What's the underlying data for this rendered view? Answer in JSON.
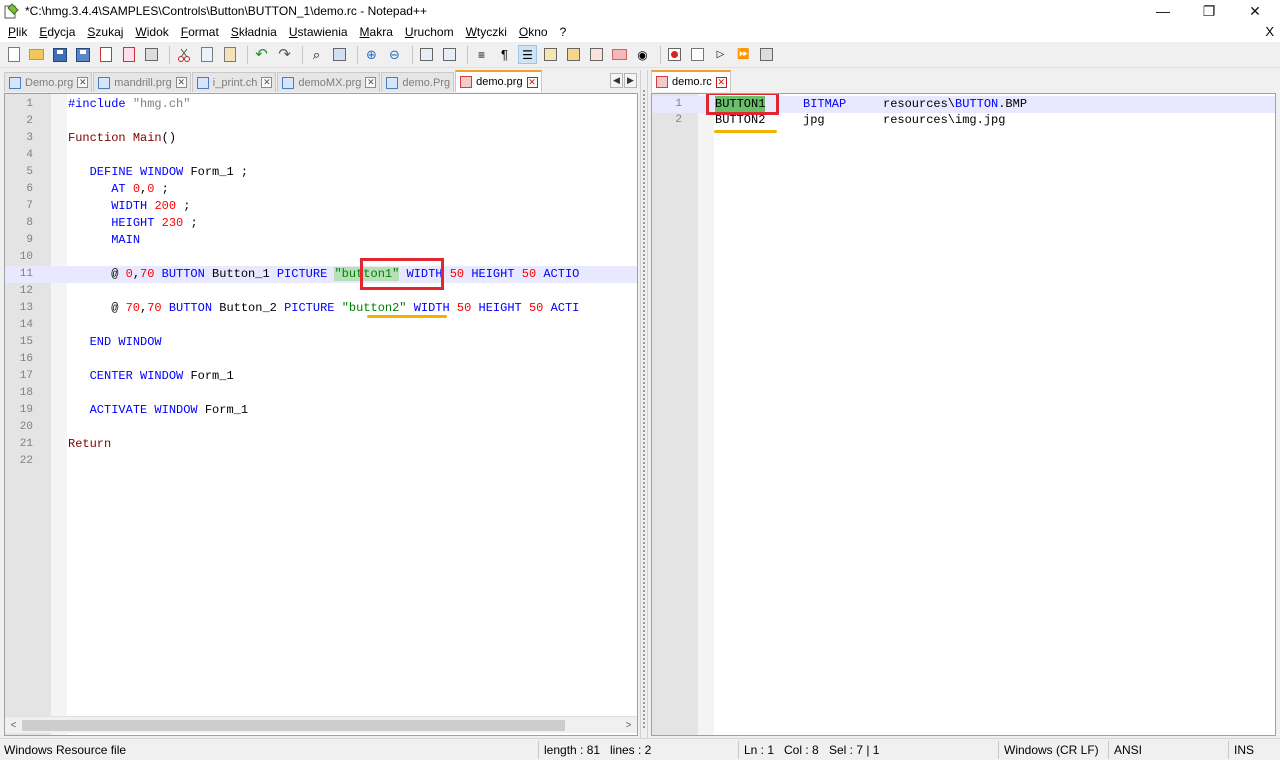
{
  "window": {
    "title": "*C:\\hmg.3.4.4\\SAMPLES\\Controls\\Button\\BUTTON_1\\demo.rc - Notepad++",
    "minimize_glyph": "—",
    "maximize_glyph": "❐",
    "close_glyph": "✕"
  },
  "menu": {
    "items": [
      "Plik",
      "Edycja",
      "Szukaj",
      "Widok",
      "Format",
      "Składnia",
      "Ustawienia",
      "Makra",
      "Uruchom",
      "Wtyczki",
      "Okno",
      "?"
    ],
    "close_label": "X"
  },
  "toolbar": {
    "icons": [
      "new-file",
      "open-file",
      "save",
      "save-all",
      "close",
      "close-all",
      "print",
      "cut",
      "copy",
      "paste",
      "undo",
      "redo",
      "find",
      "replace",
      "zoom-in",
      "zoom-out",
      "sync-vertical",
      "sync-horizontal",
      "word-wrap",
      "show-all-chars",
      "indent-guide",
      "document-map",
      "function-list",
      "folder-workspace",
      "monitoring",
      "record-macro",
      "stop-record",
      "play-macro",
      "run-macro-multiple",
      "save-macro"
    ]
  },
  "left_tabs": [
    {
      "label": "Demo.prg",
      "active": false
    },
    {
      "label": "mandrill.prg",
      "active": false
    },
    {
      "label": "i_print.ch",
      "active": false
    },
    {
      "label": "demoMX.prg",
      "active": false
    },
    {
      "label": "demo.Prg",
      "active": false
    },
    {
      "label": "demo.prg",
      "active": true
    }
  ],
  "left_tab_nav": {
    "prev": "◀",
    "next": "▶"
  },
  "right_tabs": [
    {
      "label": "demo.rc",
      "active": true
    }
  ],
  "tab_close_glyph": "✕",
  "left_editor": {
    "current_line": 11,
    "lines": [
      {
        "n": "1",
        "text": "#include \"hmg.ch\""
      },
      {
        "n": "2",
        "text": ""
      },
      {
        "n": "3",
        "text": "Function Main()"
      },
      {
        "n": "4",
        "text": ""
      },
      {
        "n": "5",
        "text": "   DEFINE WINDOW Form_1 ;"
      },
      {
        "n": "6",
        "text": "      AT 0,0 ;"
      },
      {
        "n": "7",
        "text": "      WIDTH 200 ;"
      },
      {
        "n": "8",
        "text": "      HEIGHT 230 ;"
      },
      {
        "n": "9",
        "text": "      MAIN"
      },
      {
        "n": "10",
        "text": ""
      },
      {
        "n": "11",
        "text": "      @ 0,70 BUTTON Button_1 PICTURE \"button1\" WIDTH 50 HEIGHT 50 ACTIO"
      },
      {
        "n": "12",
        "text": ""
      },
      {
        "n": "13",
        "text": "      @ 70,70 BUTTON Button_2 PICTURE \"button2\" WIDTH 50 HEIGHT 50 ACTI"
      },
      {
        "n": "14",
        "text": ""
      },
      {
        "n": "15",
        "text": "   END WINDOW"
      },
      {
        "n": "16",
        "text": ""
      },
      {
        "n": "17",
        "text": "   CENTER WINDOW Form_1"
      },
      {
        "n": "18",
        "text": ""
      },
      {
        "n": "19",
        "text": "   ACTIVATE WINDOW Form_1"
      },
      {
        "n": "20",
        "text": ""
      },
      {
        "n": "21",
        "text": "Return"
      },
      {
        "n": "22",
        "text": ""
      }
    ]
  },
  "right_editor": {
    "lines": [
      {
        "n": "1",
        "name": "BUTTON1",
        "type": "BITMAP",
        "path": "resources\\BUTTON.BMP"
      },
      {
        "n": "2",
        "name": "BUTTON2",
        "type": "jpg",
        "path": "resources\\img.jpg"
      }
    ]
  },
  "scroll": {
    "left": "<",
    "right": ">"
  },
  "status": {
    "file_type": "Windows Resource file",
    "length": "length : 81",
    "lines": "lines : 2",
    "ln": "Ln : 1",
    "col": "Col : 8",
    "sel": "Sel : 7 | 1",
    "eol": "Windows (CR LF)",
    "encoding": "ANSI",
    "mode": "INS"
  },
  "colors": {
    "keyword": "#0000ff",
    "number": "#ff0000",
    "string": "#808080",
    "highlight_box": "#e0262f",
    "underline": "#f0b400"
  }
}
